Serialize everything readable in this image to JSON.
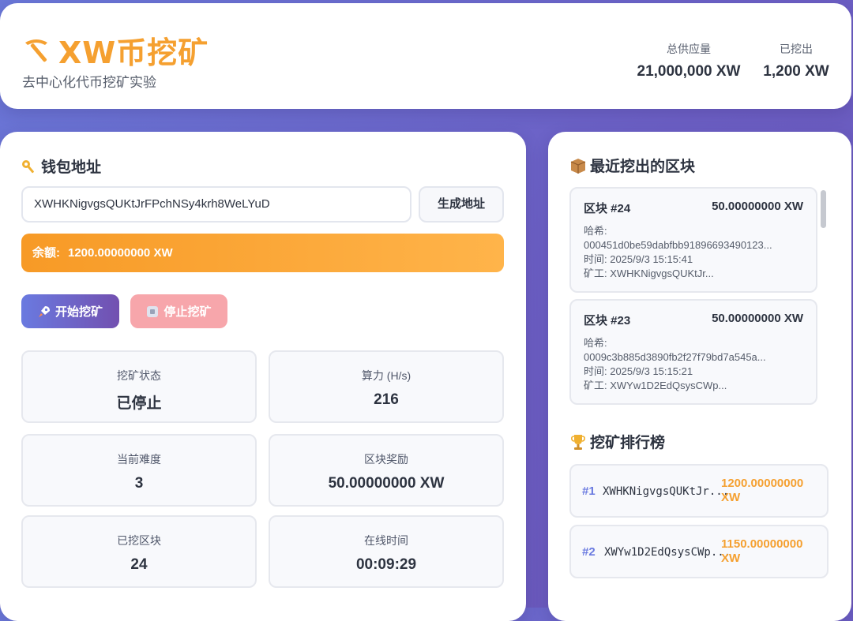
{
  "header": {
    "title": "XW币挖矿",
    "subtitle": "去中心化代币挖矿实验",
    "stats": [
      {
        "label": "总供应量",
        "value": "21,000,000 XW"
      },
      {
        "label": "已挖出",
        "value": "1,200 XW"
      }
    ]
  },
  "wallet": {
    "section_title": "钱包地址",
    "address": "XWHKNigvgsQUKtJrFPchNSy4krh8WeLYuD",
    "generate_label": "生成地址",
    "balance_label": "余额:",
    "balance_value": "1200.00000000 XW"
  },
  "controls": {
    "start_label": "开始挖矿",
    "stop_label": "停止挖矿"
  },
  "stats": [
    {
      "label": "挖矿状态",
      "value": "已停止"
    },
    {
      "label": "算力 (H/s)",
      "value": "216"
    },
    {
      "label": "当前难度",
      "value": "3"
    },
    {
      "label": "区块奖励",
      "value": "50.00000000 XW"
    },
    {
      "label": "已挖区块",
      "value": "24"
    },
    {
      "label": "在线时间",
      "value": "00:09:29"
    }
  ],
  "blocks": {
    "section_title": "最近挖出的区块",
    "items": [
      {
        "title": "区块 #24",
        "amount": "50.00000000 XW",
        "hash_label": "哈希:",
        "hash": "000451d0be59dabfbb91896693490123...",
        "time": "时间: 2025/9/3 15:15:41",
        "miner": "矿工: XWHKNigvgsQUKtJr..."
      },
      {
        "title": "区块 #23",
        "amount": "50.00000000 XW",
        "hash_label": "哈希:",
        "hash": "0009c3b885d3890fb2f27f79bd7a545a...",
        "time": "时间: 2025/9/3 15:15:21",
        "miner": "矿工: XWYw1D2EdQsysCWp..."
      }
    ]
  },
  "leaderboard": {
    "section_title": "挖矿排行榜",
    "items": [
      {
        "rank": "#1",
        "address": "XWHKNigvgsQUKtJr...",
        "amount_line1": "1200.00000000",
        "amount_line2": "XW"
      },
      {
        "rank": "#2",
        "address": "XWYw1D2EdQsysCWp...",
        "amount_line1": "1150.00000000",
        "amount_line2": "XW"
      }
    ]
  },
  "icons": {
    "brand": "pickaxe-icon",
    "wallet": "key-icon",
    "blocks": "package-icon",
    "leaderboard": "trophy-icon",
    "start": "rocket-icon",
    "stop": "stop-square-icon"
  },
  "colors": {
    "accent_orange": "#f5a030",
    "accent_purple": "#6a7ae0",
    "stop_pink": "#f7a6ab"
  }
}
